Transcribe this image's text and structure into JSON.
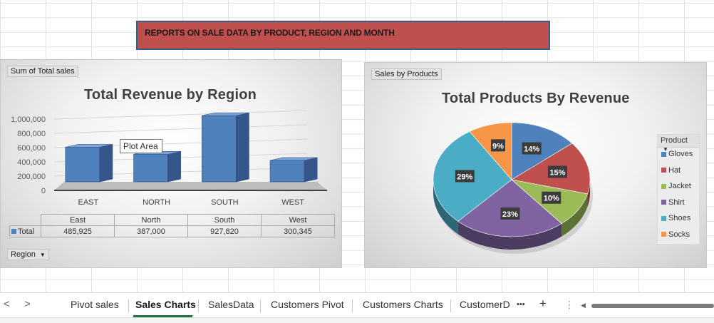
{
  "banner": {
    "text": "REPORTS ON SALE DATA  BY PRODUCT, REGION AND MONTH"
  },
  "region_chart": {
    "field_button": "Sum of Total sales",
    "row_field_button": "Region",
    "tooltip": "Plot Area"
  },
  "product_chart": {
    "field_button": "Sales by Products",
    "legend_title": "Product"
  },
  "table": {
    "headers": [
      "East",
      "North",
      "South",
      "West"
    ],
    "row_label": "Total",
    "values": [
      "485,925",
      "387,000",
      "927,820",
      "300,345"
    ]
  },
  "tabs": {
    "items": [
      "Pivot sales",
      "Sales Charts",
      "SalesData",
      "Customers Pivot",
      "Customers Charts",
      "CustomerD"
    ],
    "active": "Sales Charts",
    "more": "•••",
    "add": "+",
    "menu": "⋮",
    "prev": "<",
    "next": ">"
  },
  "colors": {
    "banner_fill": "#c0504d",
    "bar_fill": "#4f81bd",
    "active_tab": "#217346"
  },
  "chart_data": [
    {
      "type": "bar",
      "title": "Total Revenue by Region",
      "categories": [
        "EAST",
        "NORTH",
        "SOUTH",
        "WEST"
      ],
      "values": [
        485925,
        387000,
        927820,
        300345
      ],
      "xlabel": "",
      "ylabel": "",
      "ylim": [
        0,
        1000000
      ],
      "yticks": [
        "1,000,000",
        "800,000",
        "600,000",
        "400,000",
        "200,000",
        "0"
      ],
      "grid": true,
      "style": "3d-column"
    },
    {
      "type": "pie",
      "title": "Total Products By Revenue",
      "labels": [
        "Gloves",
        "Hat",
        "Jacket",
        "Shirt",
        "Shoes",
        "Socks"
      ],
      "values": [
        14,
        15,
        10,
        23,
        29,
        9
      ],
      "data_labels": [
        "14%",
        "15%",
        "10%",
        "23%",
        "29%",
        "9%"
      ],
      "colors": [
        "#4f81bd",
        "#c0504d",
        "#9bbb59",
        "#8064a2",
        "#4bacc6",
        "#f79646"
      ],
      "legend": "right",
      "style": "3d-pie"
    }
  ]
}
